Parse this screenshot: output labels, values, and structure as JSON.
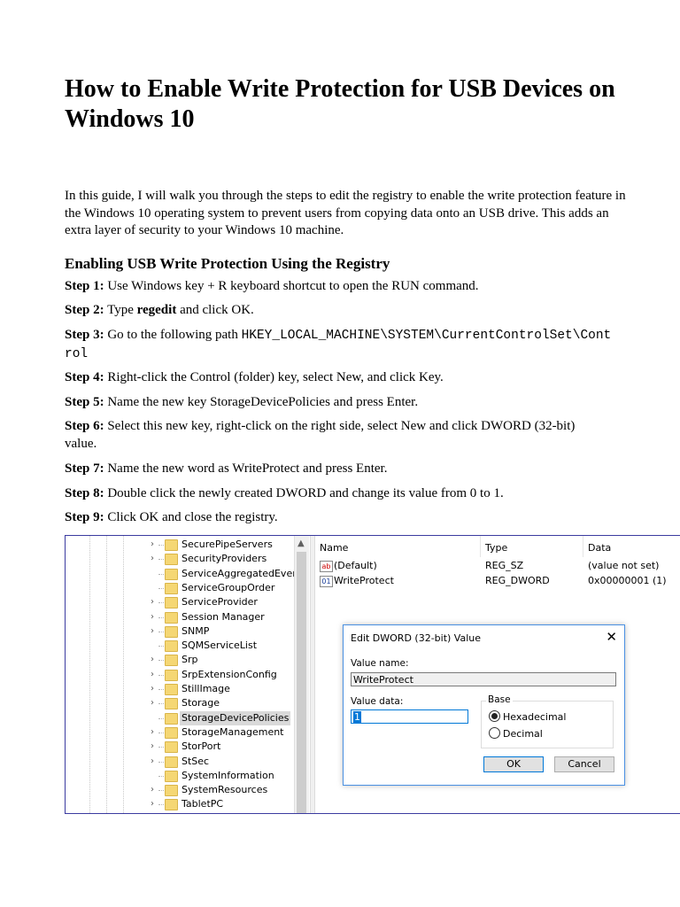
{
  "title": "How to Enable Write Protection for USB Devices on Windows 10",
  "intro": "In this guide, I will walk you through the steps to edit the registry to enable the write protection feature in the Windows 10 operating system to prevent users from copying data onto an USB drive. This adds an extra layer of security to your Windows 10 machine.",
  "section_heading": "Enabling USB Write Protection Using the Registry",
  "steps": [
    {
      "label": "Step 1:",
      "text": " Use Windows key + R keyboard shortcut to open the RUN  command."
    },
    {
      "label": "Step 2:",
      "pre": " Type ",
      "bold": "regedit",
      "post": " and click OK."
    },
    {
      "label": "Step 3:",
      "pre": " Go to the following path ",
      "code": "HKEY_LOCAL_MACHINE\\SYSTEM\\CurrentControlSet\\Control"
    },
    {
      "label": "Step 4:",
      "text": " Right-click the Control (folder) key, select New, and click Key."
    },
    {
      "label": "Step 5:",
      "text": " Name the new key StorageDevicePolicies and press Enter."
    },
    {
      "label": "Step 6:",
      "text": " Select this new key, right-click on the right side, select New and click DWORD (32-bit) value."
    },
    {
      "label": "Step 7:",
      "text": " Name the new word as WriteProtect and press Enter."
    },
    {
      "label": "Step 8:",
      "text": " Double click the newly created DWORD and change its value from 0 to 1."
    },
    {
      "label": "Step 9:",
      "text": " Click OK and close the registry."
    }
  ],
  "registry": {
    "tree_items": [
      {
        "label": "SecurePipeServers",
        "expandable": true
      },
      {
        "label": "SecurityProviders",
        "expandable": true
      },
      {
        "label": "ServiceAggregatedEvents",
        "expandable": false
      },
      {
        "label": "ServiceGroupOrder",
        "expandable": false
      },
      {
        "label": "ServiceProvider",
        "expandable": true
      },
      {
        "label": "Session Manager",
        "expandable": true
      },
      {
        "label": "SNMP",
        "expandable": true
      },
      {
        "label": "SQMServiceList",
        "expandable": false
      },
      {
        "label": "Srp",
        "expandable": true
      },
      {
        "label": "SrpExtensionConfig",
        "expandable": true
      },
      {
        "label": "StillImage",
        "expandable": true
      },
      {
        "label": "Storage",
        "expandable": true
      },
      {
        "label": "StorageDevicePolicies",
        "expandable": false,
        "selected": true
      },
      {
        "label": "StorageManagement",
        "expandable": true
      },
      {
        "label": "StorPort",
        "expandable": true
      },
      {
        "label": "StSec",
        "expandable": true
      },
      {
        "label": "SystemInformation",
        "expandable": false
      },
      {
        "label": "SystemResources",
        "expandable": true
      },
      {
        "label": "TabletPC",
        "expandable": true
      }
    ],
    "columns": {
      "name": "Name",
      "type": "Type",
      "data": "Data"
    },
    "values": [
      {
        "icon": "ab",
        "name": "(Default)",
        "type": "REG_SZ",
        "data": "(value not set)"
      },
      {
        "icon": "bin",
        "name": "WriteProtect",
        "type": "REG_DWORD",
        "data": "0x00000001 (1)"
      }
    ],
    "dialog": {
      "title": "Edit DWORD (32-bit) Value",
      "close_glyph": "✕",
      "value_name_label": "Value name:",
      "value_name": "WriteProtect",
      "value_data_label": "Value data:",
      "value_data": "1",
      "base_label": "Base",
      "hex_label": "Hexadecimal",
      "dec_label": "Decimal",
      "base_selected": "Hexadecimal",
      "ok_label": "OK",
      "cancel_label": "Cancel"
    }
  }
}
